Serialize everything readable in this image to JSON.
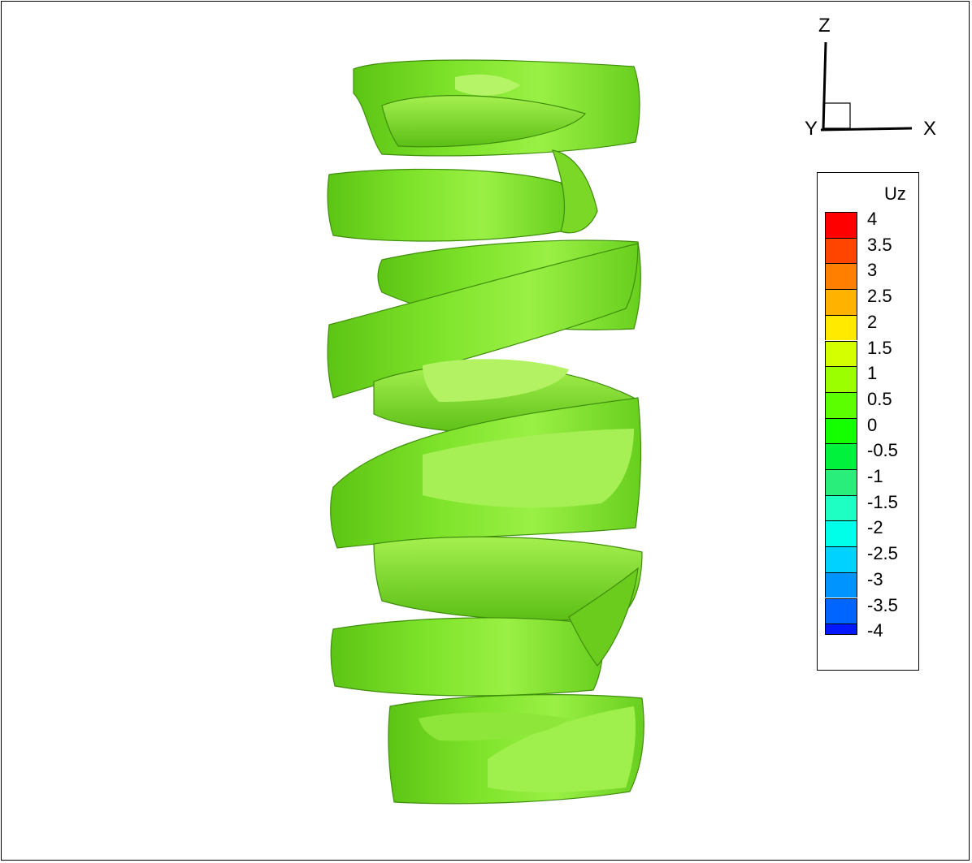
{
  "axes": {
    "x_label": "X",
    "y_label": "Y",
    "z_label": "Z"
  },
  "legend": {
    "title": "Uz",
    "levels": [
      {
        "label": "4",
        "color": "#ff0000"
      },
      {
        "label": "3.5",
        "color": "#ff4500"
      },
      {
        "label": "3",
        "color": "#ff7f00"
      },
      {
        "label": "2.5",
        "color": "#ffb300"
      },
      {
        "label": "2",
        "color": "#ffea00"
      },
      {
        "label": "1.5",
        "color": "#d4ff00"
      },
      {
        "label": "1",
        "color": "#9bff00"
      },
      {
        "label": "0.5",
        "color": "#5cff00"
      },
      {
        "label": "0",
        "color": "#14ff00"
      },
      {
        "label": "-0.5",
        "color": "#00f23c"
      },
      {
        "label": "-1",
        "color": "#2aee7c"
      },
      {
        "label": "-1.5",
        "color": "#1effc4"
      },
      {
        "label": "-2",
        "color": "#00ffe9"
      },
      {
        "label": "-2.5",
        "color": "#00d2ff"
      },
      {
        "label": "-3",
        "color": "#0094ff"
      },
      {
        "label": "-3.5",
        "color": "#0064ff"
      },
      {
        "label": "-4",
        "color": "#0018ff"
      }
    ]
  },
  "surface": {
    "base_color": "#6be01c",
    "light_color": "#a3f24a",
    "dark_color": "#4fb512"
  }
}
